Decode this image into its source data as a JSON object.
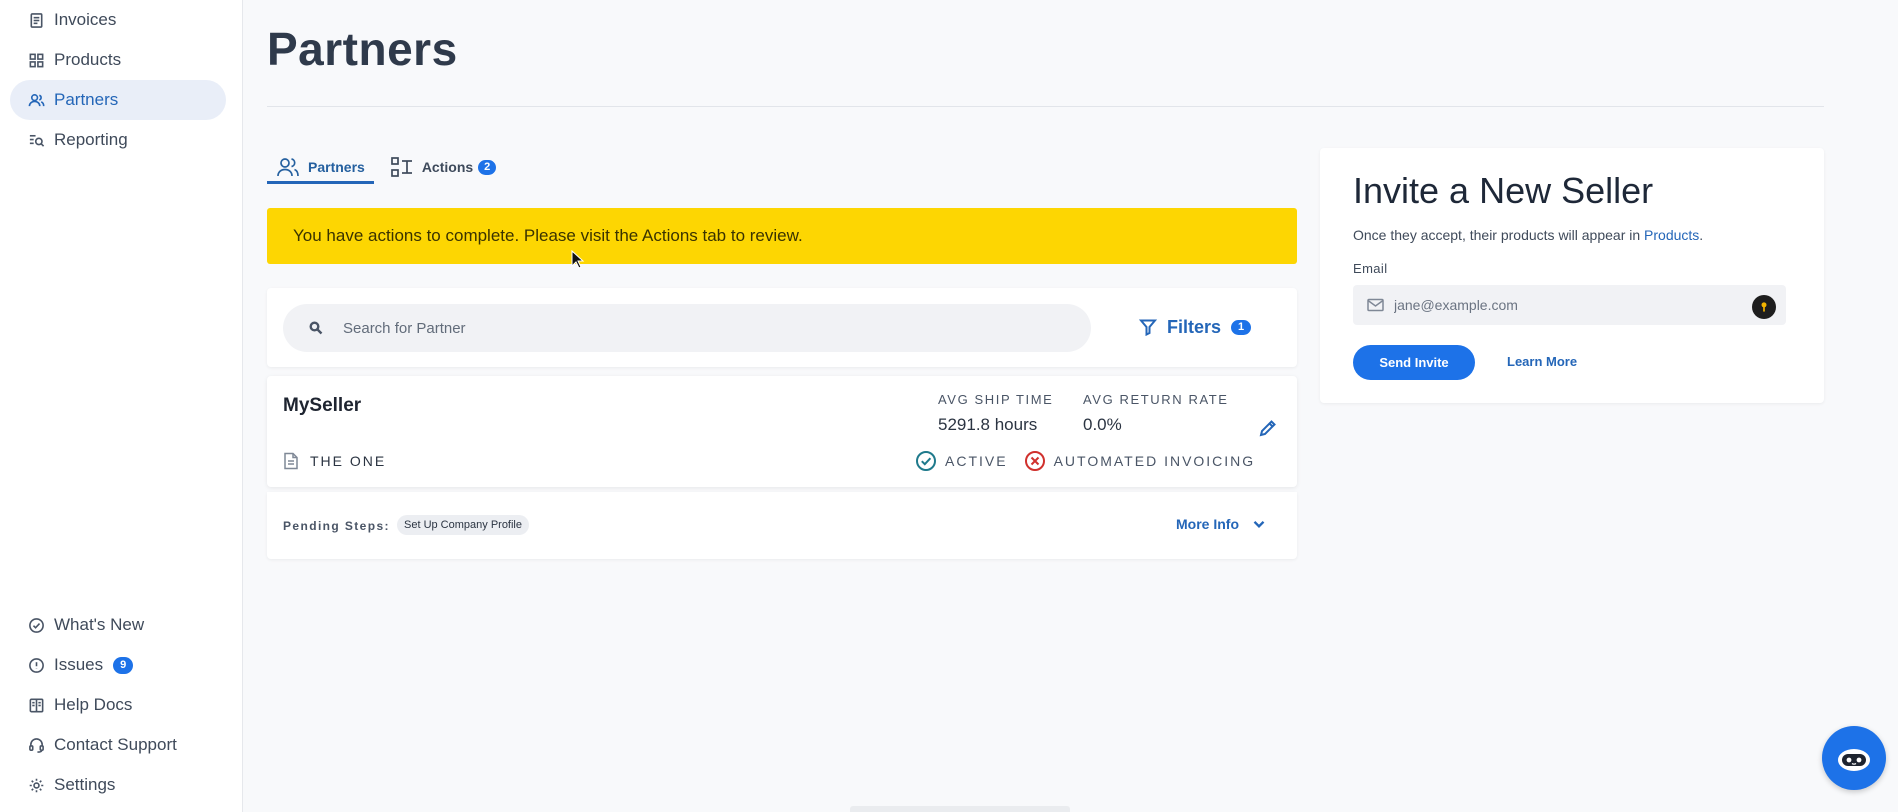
{
  "sidebar": {
    "top_items": [
      {
        "label": "Invoices",
        "icon": "invoice-icon",
        "active": false
      },
      {
        "label": "Products",
        "icon": "grid-icon",
        "active": false
      },
      {
        "label": "Partners",
        "icon": "users-icon",
        "active": true
      },
      {
        "label": "Reporting",
        "icon": "report-search-icon",
        "active": false
      }
    ],
    "bottom_items": [
      {
        "label": "What's New",
        "icon": "check-circle-icon"
      },
      {
        "label": "Issues",
        "icon": "alert-circle-icon",
        "badge": "9"
      },
      {
        "label": "Help Docs",
        "icon": "docs-icon"
      },
      {
        "label": "Contact Support",
        "icon": "headset-icon"
      },
      {
        "label": "Settings",
        "icon": "gear-icon"
      }
    ]
  },
  "page": {
    "title": "Partners"
  },
  "tabs": [
    {
      "label": "Partners",
      "icon": "users-icon",
      "active": true
    },
    {
      "label": "Actions",
      "icon": "workflow-icon",
      "badge": "2",
      "active": false
    }
  ],
  "alert": {
    "text": "You have actions to complete. Please visit the Actions tab to review.",
    "color": "#fdd602"
  },
  "search": {
    "placeholder": "Search for Partner",
    "value": "",
    "filters_label": "Filters",
    "filters_count": "1"
  },
  "partner": {
    "name": "MySeller",
    "subtitle": "THE ONE",
    "stats": [
      {
        "label": "AVG SHIP TIME",
        "value": "5291.8 hours"
      },
      {
        "label": "AVG RETURN RATE",
        "value": "0.0%"
      }
    ],
    "statuses": [
      {
        "label": "ACTIVE",
        "state": "ok",
        "color": "#1f7a8c"
      },
      {
        "label": "AUTOMATED INVOICING",
        "state": "error",
        "color": "#d0312d"
      }
    ],
    "pending_label": "Pending Steps:",
    "pending_steps": [
      "Set Up Company Profile"
    ],
    "more_info_label": "More Info"
  },
  "invite": {
    "title": "Invite a New Seller",
    "desc_prefix": "Once they accept, their products will appear in ",
    "desc_link": "Products",
    "desc_suffix": ".",
    "email_label": "Email",
    "email_placeholder": "jane@example.com",
    "email_value": "",
    "send_label": "Send Invite",
    "learn_more_label": "Learn More"
  },
  "colors": {
    "accent": "#1d72e8",
    "link": "#2466b8",
    "sidebar_active_bg": "#e9eef8"
  }
}
